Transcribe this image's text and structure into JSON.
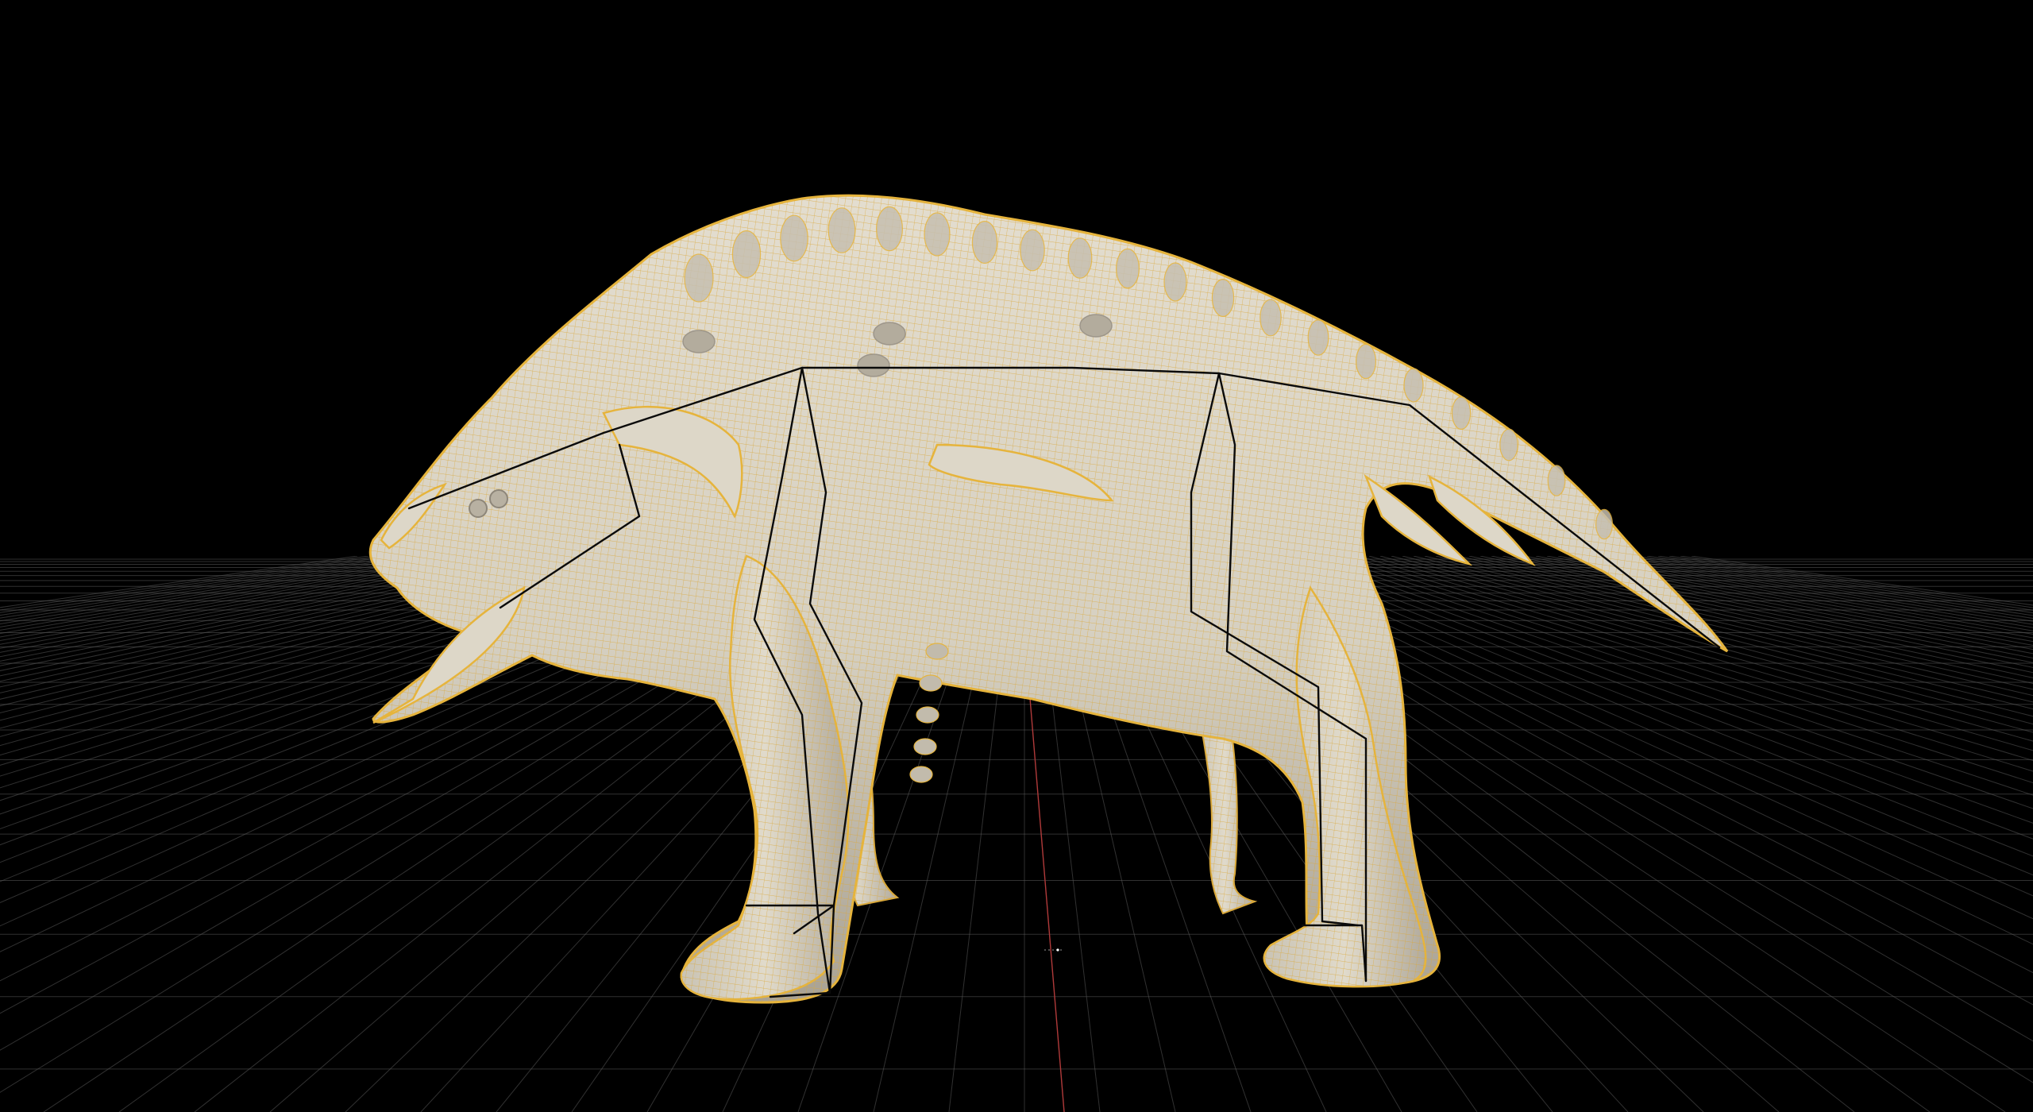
{
  "viewport": {
    "background": "#000000",
    "grid_color": "#5a5a5a",
    "origin_axis_color": "#b03a3a",
    "mesh_fill_color": "#d9d3c4",
    "mesh_shadow_color": "#a9a294",
    "wireframe_color": "#e6b43c",
    "skeleton_color": "#0a0a0a"
  },
  "scene": {
    "object": "creature-mesh",
    "display_mode": "shaded-with-wireframe",
    "skeleton_visible": true,
    "ground_grid_visible": true
  }
}
